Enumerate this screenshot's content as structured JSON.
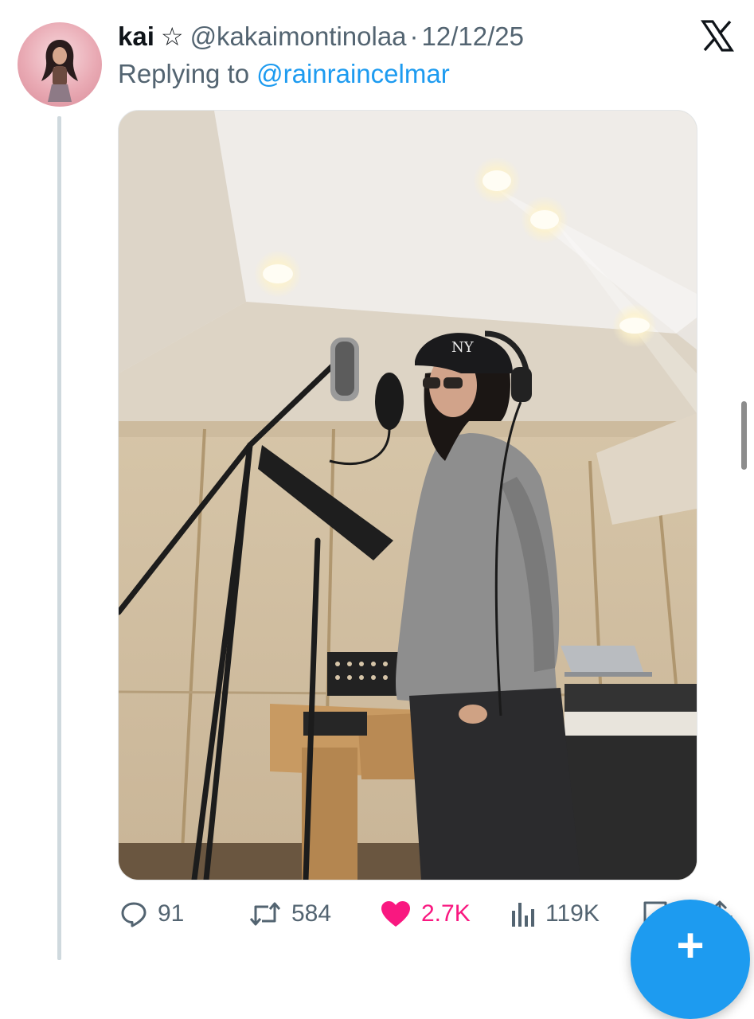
{
  "tweet": {
    "display_name": "kai",
    "name_badge": "☆",
    "handle": "@kakaimontinolaa",
    "separator": "·",
    "date": "12/12/25",
    "replying_label": "Replying to",
    "replying_to": "@rainraincelmar",
    "platform_icon": "x-logo-icon"
  },
  "media": {
    "photo_icon": "recording-studio-photo"
  },
  "actions": {
    "replies": "91",
    "retweets": "584",
    "likes": "2.7K",
    "views": "119K",
    "liked": true
  },
  "fab": {
    "icon": "plus-icon",
    "label": "+"
  },
  "colors": {
    "accent": "#1d9bf0",
    "like": "#f91880",
    "secondary_text": "#536471",
    "primary_text": "#0f1419",
    "thread_line": "#cfd9de"
  }
}
